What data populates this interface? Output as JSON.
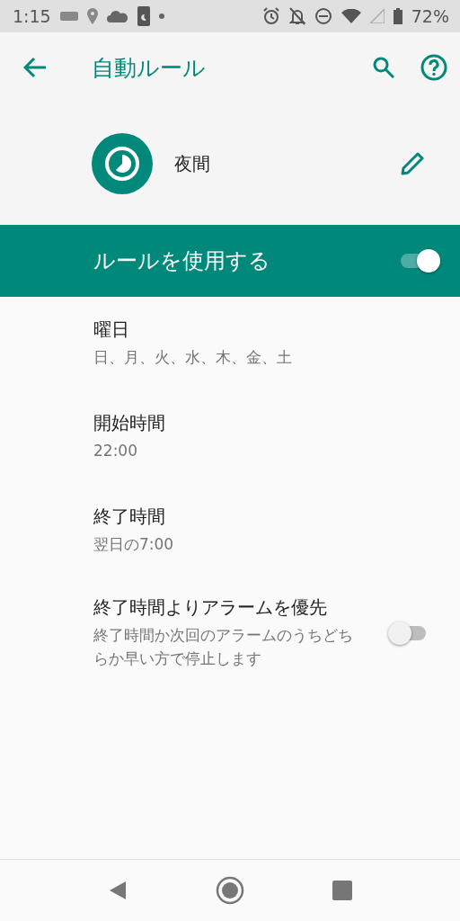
{
  "status_bar": {
    "time": "1:15",
    "battery": "72%"
  },
  "app_bar": {
    "title": "自動ルール"
  },
  "rule": {
    "name": "夜間"
  },
  "master_switch": {
    "label": "ルールを使用する",
    "on": true
  },
  "settings": [
    {
      "kind": "text",
      "title": "曜日",
      "summary": "日、月、火、水、木、金、土"
    },
    {
      "kind": "text",
      "title": "開始時間",
      "summary": "22:00"
    },
    {
      "kind": "text",
      "title": "終了時間",
      "summary": "翌日の7:00"
    },
    {
      "kind": "switch",
      "title": "終了時間よりアラームを優先",
      "summary": "終了時間か次回のアラームのうちどちらか早い方で停止します",
      "on": false
    }
  ]
}
